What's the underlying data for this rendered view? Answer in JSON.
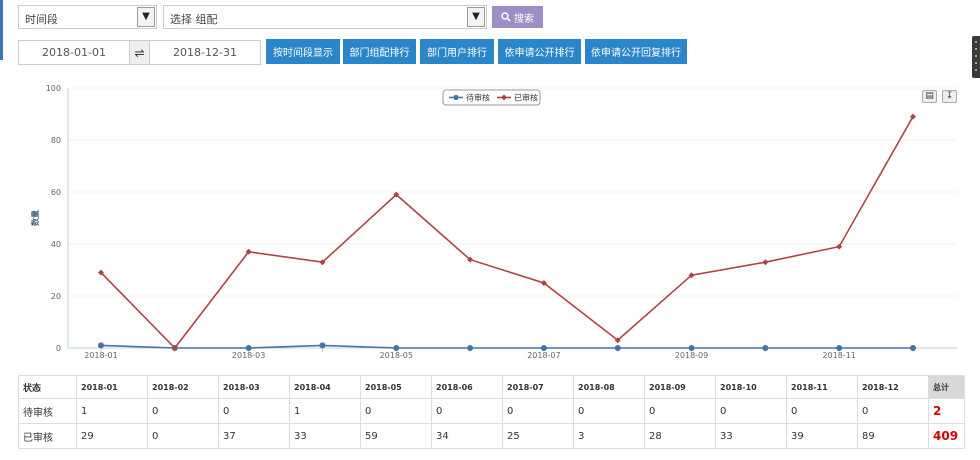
{
  "filters": {
    "period_select": "时间段",
    "group_select": "选择 组配",
    "search_label": "搜索"
  },
  "date_range": {
    "start": "2018-01-01",
    "end": "2018-12-31"
  },
  "toolbar": {
    "buttons": [
      "按时间段显示",
      "部门组配排行",
      "部门用户排行",
      "依申请公开排行",
      "依申请公开回复排行"
    ]
  },
  "chart_data": {
    "type": "line",
    "ylabel": "数量",
    "ylim": [
      0,
      100
    ],
    "yticks": [
      0,
      20,
      40,
      60,
      80,
      100
    ],
    "x": [
      "2018-01",
      "2018-02",
      "2018-03",
      "2018-04",
      "2018-05",
      "2018-06",
      "2018-07",
      "2018-08",
      "2018-09",
      "2018-10",
      "2018-11",
      "2018-12"
    ],
    "xtick_labels": [
      "2018-01",
      "2018-03",
      "2018-05",
      "2018-07",
      "2018-09",
      "2018-11"
    ],
    "legend_position": "top-center",
    "series": [
      {
        "name": "待审核",
        "color": "#4572a7",
        "values": [
          1,
          0,
          0,
          1,
          0,
          0,
          0,
          0,
          0,
          0,
          0,
          0
        ]
      },
      {
        "name": "已审核",
        "color": "#aa4643",
        "values": [
          29,
          0,
          37,
          33,
          59,
          34,
          25,
          3,
          28,
          33,
          39,
          89
        ]
      }
    ]
  },
  "table": {
    "status_header": "状态",
    "months": [
      "2018-01",
      "2018-02",
      "2018-03",
      "2018-04",
      "2018-05",
      "2018-06",
      "2018-07",
      "2018-08",
      "2018-09",
      "2018-10",
      "2018-11",
      "2018-12"
    ],
    "total_header": "总计",
    "rows": [
      {
        "label": "待审核",
        "values": [
          "1",
          "0",
          "0",
          "1",
          "0",
          "0",
          "0",
          "0",
          "0",
          "0",
          "0",
          "0"
        ],
        "total": "2"
      },
      {
        "label": "已审核",
        "values": [
          "29",
          "0",
          "37",
          "33",
          "59",
          "34",
          "25",
          "3",
          "28",
          "33",
          "39",
          "89"
        ],
        "total": "409"
      }
    ]
  },
  "chart_tools": {
    "print_icon": "printer-icon",
    "export_icon": "download-icon"
  }
}
